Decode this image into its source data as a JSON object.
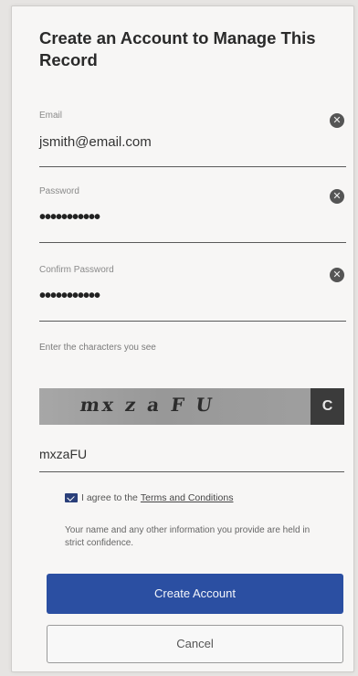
{
  "form": {
    "title": "Create an Account to Manage This Record",
    "email": {
      "label": "Email",
      "value": "jsmith@email.com"
    },
    "password": {
      "label": "Password",
      "value": "•••••••••••"
    },
    "confirm_password": {
      "label": "Confirm Password",
      "value": "•••••••••••"
    },
    "clear_glyph": "✕",
    "captcha": {
      "label": "Enter the characters you see",
      "image_text": "mx z a F U",
      "refresh_glyph": "C",
      "input_value": "mxzaFU"
    },
    "agree": {
      "prefix": "I agree to the",
      "link": "Terms and Conditions",
      "checked": true
    },
    "privacy_note": "Your name and any other information you provide are held in strict confidence.",
    "create_button": "Create Account",
    "cancel_button": "Cancel",
    "colors": {
      "primary": "#2b4fa2",
      "checkbox": "#2a3f7a"
    }
  }
}
